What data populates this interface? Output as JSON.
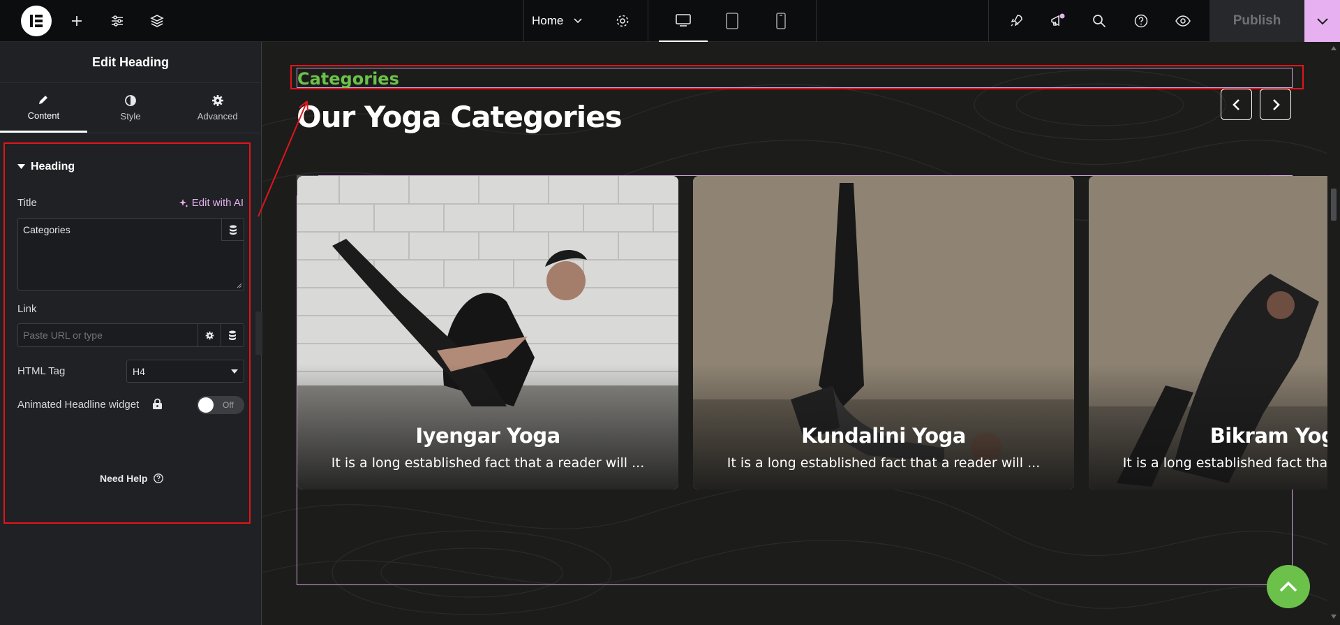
{
  "topbar": {
    "page_name": "Home",
    "publish_label": "Publish"
  },
  "panel": {
    "title": "Edit Heading",
    "tabs": [
      {
        "label": "Content",
        "icon": "pencil-icon"
      },
      {
        "label": "Style",
        "icon": "half-circle-icon"
      },
      {
        "label": "Advanced",
        "icon": "gear-icon"
      }
    ],
    "section_title": "Heading",
    "title_label": "Title",
    "edit_ai_label": "Edit with AI",
    "title_value": "Categories",
    "link_label": "Link",
    "link_placeholder": "Paste URL or type",
    "html_tag_label": "HTML Tag",
    "html_tag_value": "H4",
    "animated_label": "Animated Headline widget",
    "toggle_label": "Off",
    "need_help": "Need Help"
  },
  "canvas": {
    "subheading": "Categories",
    "heading": "Our Yoga Categories",
    "cards": [
      {
        "title": "Iyengar Yoga",
        "text": "It is a long established fact that a reader will ..."
      },
      {
        "title": "Kundalini Yoga",
        "text": "It is a long established fact that a reader will ..."
      },
      {
        "title": "Bikram Yoga",
        "text": "It is a long established fact that a reader will ..."
      }
    ]
  },
  "colors": {
    "accent_pink": "#e7b0f0",
    "heading_green": "#6cc14b",
    "highlight_red": "#e3141b",
    "scroll_top_green": "#6cc14b"
  }
}
